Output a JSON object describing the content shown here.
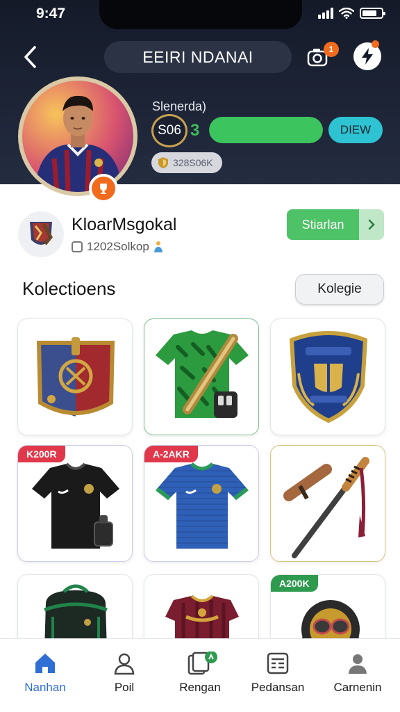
{
  "status_bar": {
    "time": "9:47"
  },
  "header": {
    "title": "EEIRI NDANAI",
    "notification_count": "1"
  },
  "stats": {
    "label": "Slenerda)",
    "level": "S06",
    "level_suffix": "3",
    "progress": 1.0,
    "view_button": "DIEW",
    "coins": "328S06K"
  },
  "profile": {
    "name": "KloarMsgokal",
    "id_text": "1202Solkop"
  },
  "share_button": "Stiarlan",
  "section": {
    "title": "Kolectioens",
    "button": "Kolegie"
  },
  "collection": [
    {
      "name": "crest-badge",
      "tag": ""
    },
    {
      "name": "green-jersey",
      "tag": ""
    },
    {
      "name": "shield-badge",
      "tag": ""
    },
    {
      "name": "black-jersey",
      "tag": "K200R",
      "tag_color": "#e0384a"
    },
    {
      "name": "blue-jersey",
      "tag": "A-2AKR",
      "tag_color": "#e0384a"
    },
    {
      "name": "bat-and-stick",
      "tag": ""
    },
    {
      "name": "backpack",
      "tag": ""
    },
    {
      "name": "maroon-jersey",
      "tag": ""
    },
    {
      "name": "helmet",
      "tag": "A200K",
      "tag_color": "#2e9a4e"
    }
  ],
  "tabs": [
    {
      "label": "Nanhan",
      "icon": "home-icon",
      "active": true
    },
    {
      "label": "Poil",
      "icon": "person-icon",
      "active": false
    },
    {
      "label": "Rengan",
      "icon": "cards-icon",
      "active": false
    },
    {
      "label": "Pedansan",
      "icon": "grid-icon",
      "active": false
    },
    {
      "label": "Carnenin",
      "icon": "profile-icon",
      "active": false
    }
  ],
  "colors": {
    "accent_green": "#3cc55e",
    "accent_orange": "#f26b1d",
    "accent_blue": "#2f6fd3",
    "header_bg": "#1d2436"
  }
}
